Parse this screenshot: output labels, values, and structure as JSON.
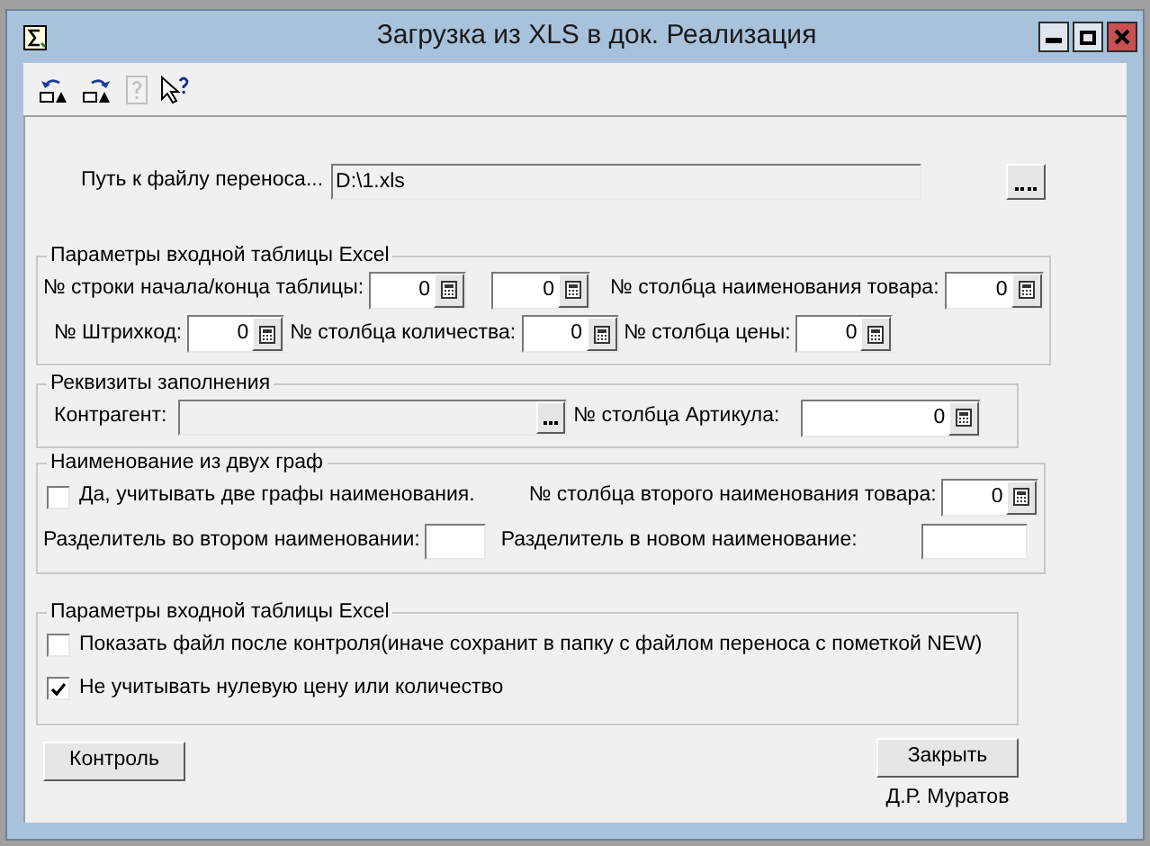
{
  "window": {
    "title": "Загрузка из XLS в док. Реализация"
  },
  "toolbar": [
    {
      "kind": "undo",
      "disabled": false
    },
    {
      "kind": "redo",
      "disabled": false
    },
    {
      "kind": "help",
      "disabled": true
    },
    {
      "kind": "pointer-help",
      "disabled": false
    }
  ],
  "file_path": {
    "label": "Путь к файлу переноса...",
    "value": "D:\\1.xls"
  },
  "excel_params": {
    "title": "Параметры входной таблицы Excel",
    "start_end_label": "№ строки начала/конца таблицы:",
    "start_row": "0",
    "end_row": "0",
    "name_column_label": "№ столбца наименования товара:",
    "name_column": "0",
    "barcode_label": "№ Штрихкод:",
    "barcode": "0",
    "quantity_label": "№ столбца количества:",
    "quantity": "0",
    "price_label": "№ столбца цены:",
    "price": "0"
  },
  "fill": {
    "title": "Реквизиты заполнения",
    "counterparty_label": "Контрагент:",
    "article_label": "№ столбца Артикула:",
    "article": "0"
  },
  "two_columns": {
    "title": "Наименование из двух граф",
    "checkbox": {
      "label": "Да, учитывать две графы наименования.",
      "checked": false
    },
    "second_name_label": "№ столбца второго наименования товара:",
    "second_name": "0",
    "sep_second_label": "Разделитель во втором наименовании:",
    "sep_new_label": "Разделитель в новом наименование:"
  },
  "options": {
    "title": "Параметры входной таблицы Excel",
    "checkboxes": [
      {
        "label": "Показать файл после контроля(иначе сохранит в папку с файлом переноса с пометкой NEW)",
        "checked": false
      },
      {
        "label": "Не учитывать нулевую цену или количество",
        "checked": true
      }
    ]
  },
  "buttons": {
    "control": "Контроль",
    "close": "Закрыть"
  },
  "author": "Д.Р. Муратов"
}
